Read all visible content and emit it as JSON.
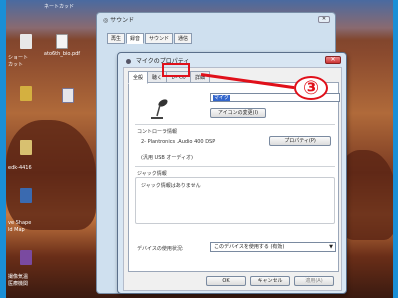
{
  "desktop": {
    "top_label": "ネートカッド",
    "icons": [
      {
        "label": "ショート\nカット"
      },
      {
        "label": "ato6th_bio.pdf"
      },
      {
        "label": ""
      },
      {
        "label": ""
      }
    ],
    "left_labels": [
      {
        "text": "ショート"
      },
      {
        "text": "カット"
      },
      {
        "text": "edk-4416"
      },
      {
        "text": "ve Shape"
      },
      {
        "text": "ld Map"
      },
      {
        "text": "撮像気温"
      },
      {
        "text": "医療機関"
      }
    ]
  },
  "sound_dialog": {
    "title": "サウンド",
    "close_label": "✕",
    "tabs": [
      "再生",
      "録音",
      "サウンド",
      "通信"
    ],
    "active_tab": "録音"
  },
  "mic_dialog": {
    "title": "マイクのプロパティ",
    "close_label": "✕",
    "tabs": [
      "全般",
      "聴く",
      "レベル",
      "詳細"
    ],
    "active_tab": "全般",
    "highlighted_tab": "レベル",
    "name_value": "マイク",
    "change_icon_button": "アイコンの変更(I)",
    "controller_section": "コントローラ情報",
    "controller_name": "2- Plantronics .Audio 400 DSP",
    "controller_driver": "(汎用 USB オーディオ)",
    "properties_button": "プロパティ(P)",
    "jack_section": "ジャック情報",
    "jack_text": "ジャック情報はありません",
    "device_usage_label": "デバイスの使用状況:",
    "device_usage_value": "このデバイスを使用する (有効)",
    "ok_button": "OK",
    "cancel_button": "キャンセル",
    "apply_button": "適用(A)"
  },
  "annotation": {
    "number": "③",
    "color": "#e0101a"
  }
}
